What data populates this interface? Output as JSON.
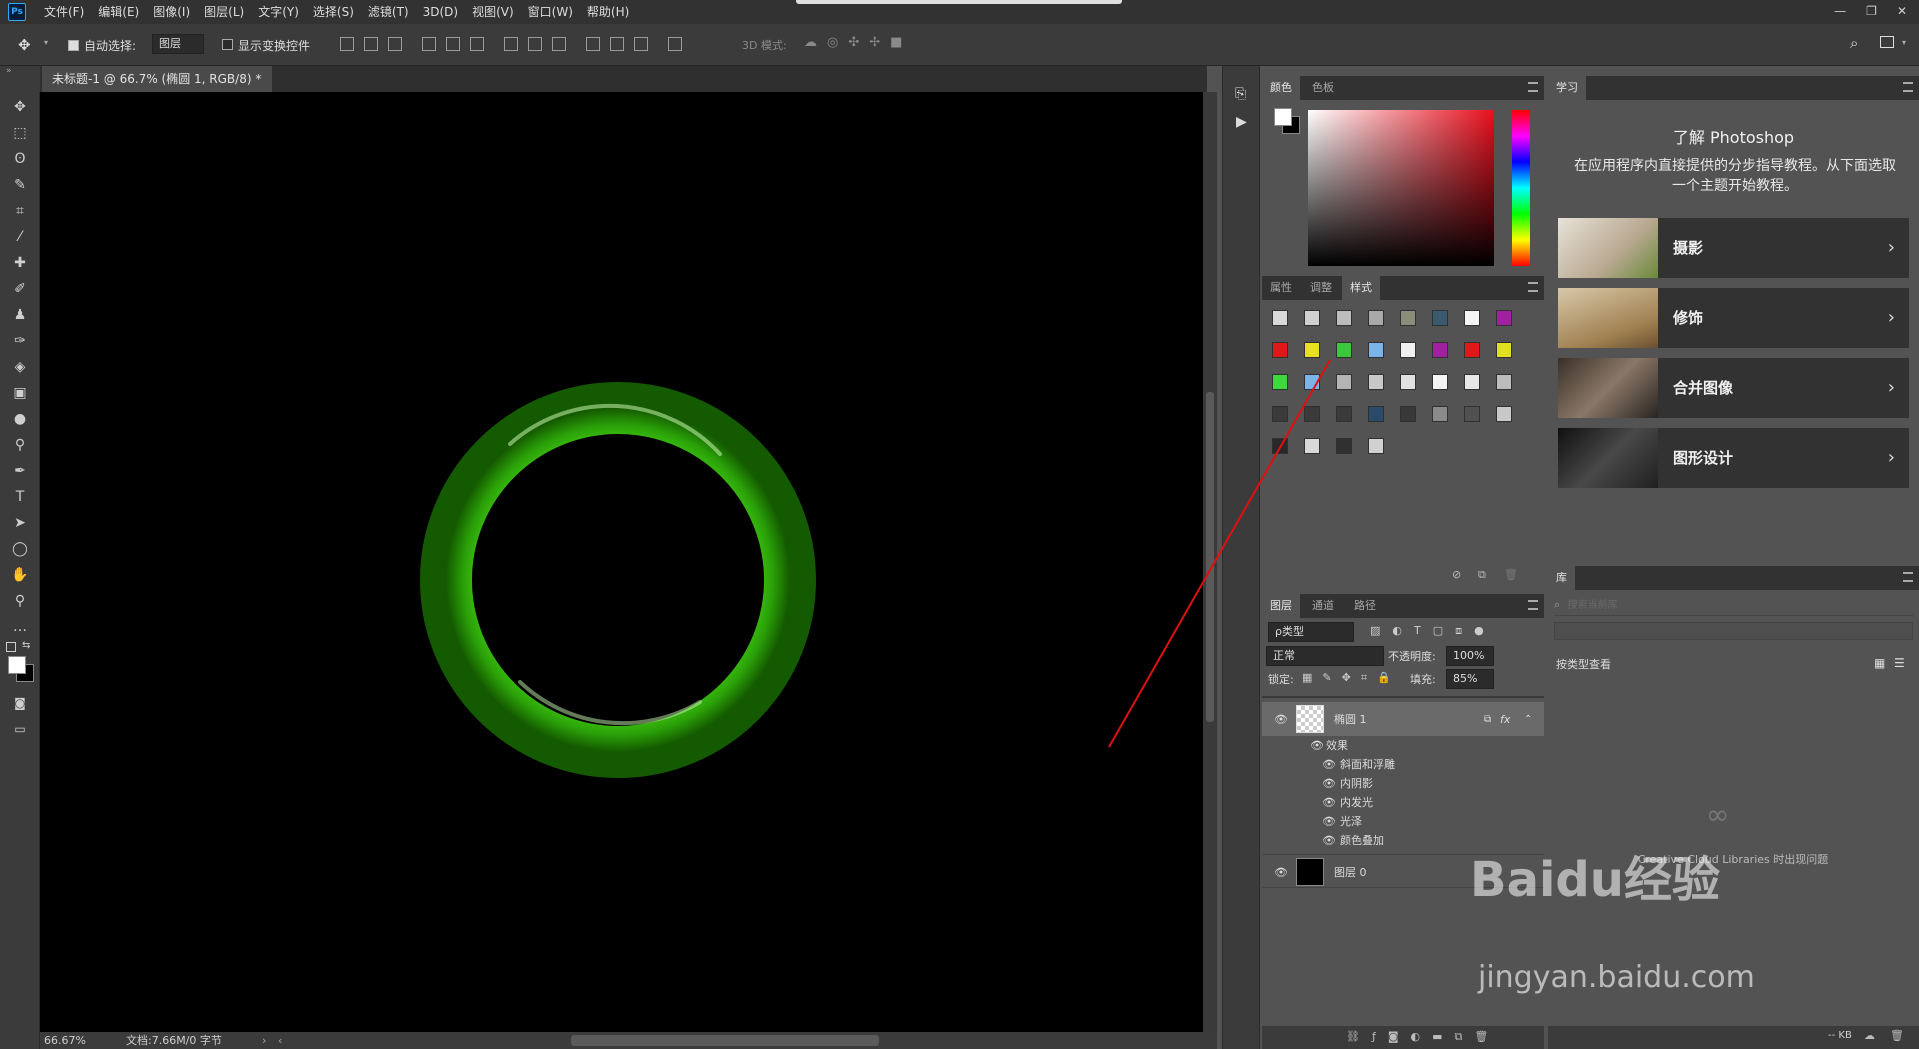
{
  "menubar": {
    "logo": "Ps",
    "items": [
      "文件(F)",
      "编辑(E)",
      "图像(I)",
      "图层(L)",
      "文字(Y)",
      "选择(S)",
      "滤镜(T)",
      "3D(D)",
      "视图(V)",
      "窗口(W)",
      "帮助(H)"
    ],
    "window_controls": [
      "—",
      "❐",
      "✕"
    ]
  },
  "optionsbar": {
    "auto_select_label": "自动选择:",
    "auto_select_value": "图层",
    "show_transform_label": "显示变换控件",
    "mode_3d_label": "3D 模式:"
  },
  "document": {
    "tab_title": "未标题-1 @ 66.7% (椭圆 1, RGB/8) *",
    "tab_close": "×",
    "zoom": "66.67%",
    "doc_info": "文档:7.66M/0 字节"
  },
  "color_panel": {
    "tabs": [
      "颜色",
      "色板"
    ],
    "foreground": "#ffffff",
    "background": "#000000"
  },
  "styles_panel": {
    "tabs": [
      "属性",
      "调整",
      "样式"
    ],
    "swatches": [
      "#d8d8d8",
      "#cfcfcf",
      "#bdbdbd",
      "#a9a9a9",
      "#8c8c7a",
      "#3c5a6e",
      "#f4f4f4",
      "#a020a0",
      "#e01818",
      "#e8e020",
      "#3cc83c",
      "#7ab4e8",
      "#f0f0f0",
      "#a020a0",
      "#e01818",
      "#e0e020",
      "#3cd83c",
      "#7ab4e8",
      "#b4b4b4",
      "#c8c8c8",
      "#e0e0e0",
      "#f4f4f4",
      "#e8e8e8",
      "#bcbcbc",
      "#3a3a3a",
      "#3a3a3a",
      "#3a3a3a",
      "#2a4a6a",
      "#383838",
      "#8a8a8a",
      "#505050",
      "#c8c8c8",
      "#282828",
      "#d8d8d8",
      "#303030",
      "#d0d0d0"
    ]
  },
  "layers_panel": {
    "tabs": [
      "图层",
      "通道",
      "路径"
    ],
    "filter_label": "ρ类型",
    "blend_mode": "正常",
    "opacity_label": "不透明度:",
    "opacity_value": "100%",
    "lock_label": "锁定:",
    "fill_label": "填充:",
    "fill_value": "85%",
    "layers": [
      {
        "name": "椭圆 1",
        "fx": "fx"
      },
      {
        "name": "图层 0"
      }
    ],
    "effects_label": "效果",
    "effects": [
      "斜面和浮雕",
      "内阴影",
      "内发光",
      "光泽",
      "颜色叠加"
    ]
  },
  "learn_panel": {
    "tab": "学习",
    "title": "了解 Photoshop",
    "description": "在应用程序内直接提供的分步指导教程。从下面选取一个主题开始教程。",
    "cards": [
      "摄影",
      "修饰",
      "合并图像",
      "图形设计"
    ]
  },
  "library_panel": {
    "tab": "库",
    "search_placeholder": "搜索当前库",
    "view_by_type": "按类型查看",
    "cc_message": "Creative Cloud Libraries 时出现问题",
    "status_kb": "-- KB"
  },
  "watermark": {
    "brand": "Baidu经验",
    "url": "jingyan.baidu.com"
  },
  "colors": {
    "ring_green": "#2a9e08",
    "annotation_red": "#e01010"
  }
}
